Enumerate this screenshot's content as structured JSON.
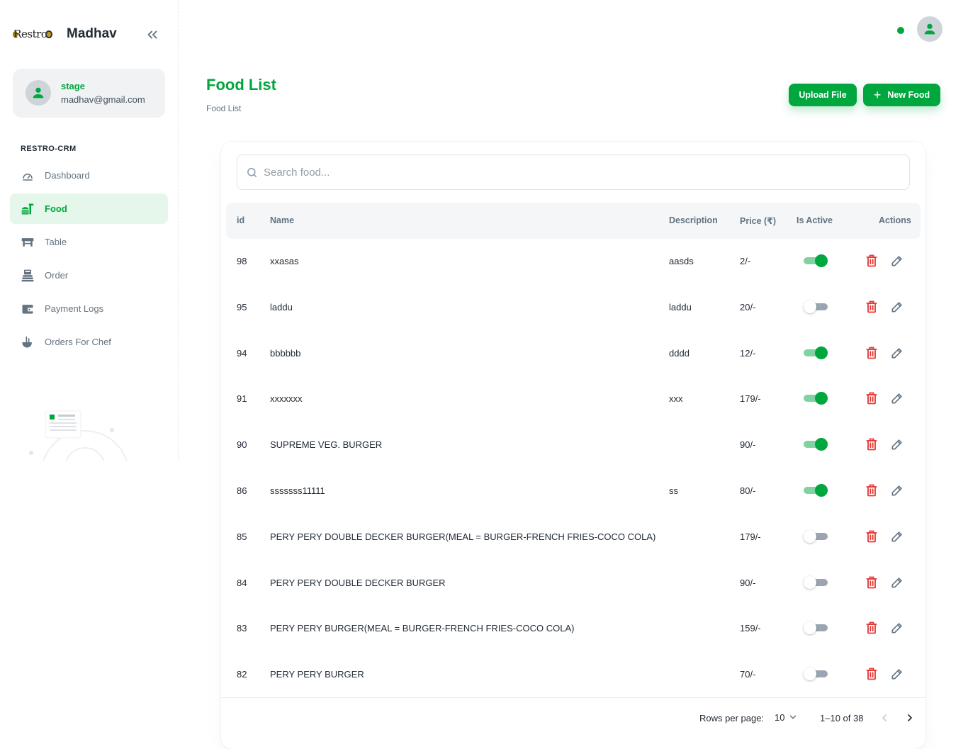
{
  "brand": {
    "logo_text": "Restro",
    "name": "Madhav"
  },
  "user": {
    "name": "stage",
    "email": "madhav@gmail.com"
  },
  "sidebar": {
    "section": "RESTRO-CRM",
    "items": [
      {
        "label": "Dashboard",
        "icon": "dashboard-icon",
        "active": false
      },
      {
        "label": "Food",
        "icon": "food-icon",
        "active": true
      },
      {
        "label": "Table",
        "icon": "table-icon",
        "active": false
      },
      {
        "label": "Order",
        "icon": "order-icon",
        "active": false
      },
      {
        "label": "Payment Logs",
        "icon": "wallet-icon",
        "active": false
      },
      {
        "label": "Orders For Chef",
        "icon": "chef-icon",
        "active": false
      }
    ]
  },
  "header": {
    "title": "Food List",
    "breadcrumb": "Food List",
    "upload_label": "Upload File",
    "new_label": "New Food"
  },
  "search": {
    "placeholder": "Search food..."
  },
  "table": {
    "columns": {
      "id": "id",
      "name": "Name",
      "description": "Description",
      "price": "Price (₹)",
      "active": "Is Active",
      "actions": "Actions"
    },
    "rows": [
      {
        "id": "98",
        "name": "xxasas",
        "description": "aasds",
        "price": "2/-",
        "active": true
      },
      {
        "id": "95",
        "name": "laddu",
        "description": "laddu",
        "price": "20/-",
        "active": false
      },
      {
        "id": "94",
        "name": "bbbbbb",
        "description": "dddd",
        "price": "12/-",
        "active": true
      },
      {
        "id": "91",
        "name": "xxxxxxx",
        "description": "xxx",
        "price": "179/-",
        "active": true
      },
      {
        "id": "90",
        "name": "SUPREME VEG. BURGER",
        "description": "",
        "price": "90/-",
        "active": true
      },
      {
        "id": "86",
        "name": "sssssss11111",
        "description": "ss",
        "price": "80/-",
        "active": true
      },
      {
        "id": "85",
        "name": "PERY PERY DOUBLE DECKER BURGER(MEAL = BURGER-FRENCH FRIES-COCO COLA)",
        "description": "",
        "price": "179/-",
        "active": false
      },
      {
        "id": "84",
        "name": "PERY PERY DOUBLE DECKER BURGER",
        "description": "",
        "price": "90/-",
        "active": false
      },
      {
        "id": "83",
        "name": "PERY PERY BURGER(MEAL = BURGER-FRENCH FRIES-COCO COLA)",
        "description": "",
        "price": "159/-",
        "active": false
      },
      {
        "id": "82",
        "name": "PERY PERY BURGER",
        "description": "",
        "price": "70/-",
        "active": false
      }
    ]
  },
  "pagination": {
    "rows_label": "Rows per page:",
    "rows_value": "10",
    "range": "1–10 of 38"
  },
  "colors": {
    "primary": "#00a63e",
    "danger": "#e53935",
    "muted": "#637381"
  }
}
